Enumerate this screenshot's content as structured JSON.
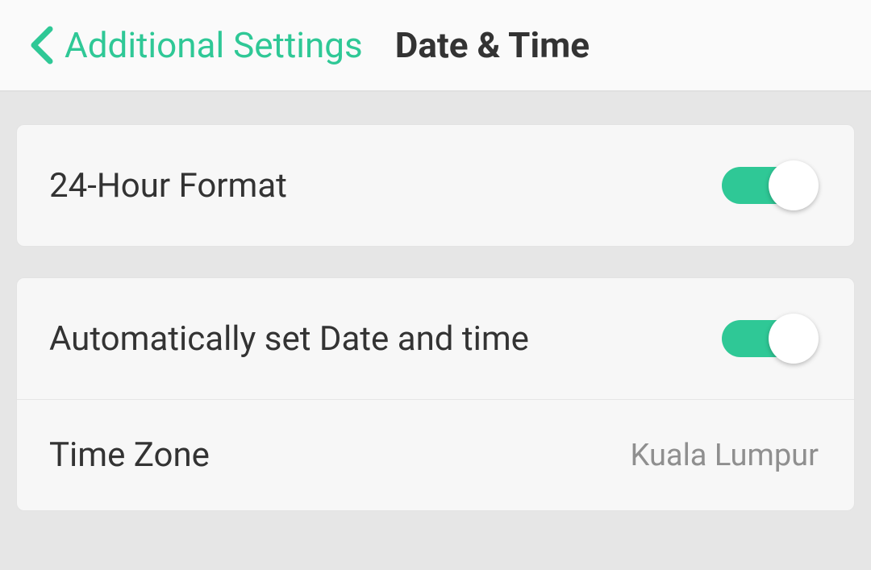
{
  "header": {
    "back_label": "Additional Settings",
    "page_title": "Date & Time"
  },
  "settings": {
    "hour_format": {
      "label": "24-Hour Format",
      "enabled": true
    },
    "auto_date_time": {
      "label": "Automatically set Date and time",
      "enabled": true
    },
    "time_zone": {
      "label": "Time Zone",
      "value": "Kuala Lumpur"
    }
  },
  "colors": {
    "accent": "#2fc896"
  }
}
